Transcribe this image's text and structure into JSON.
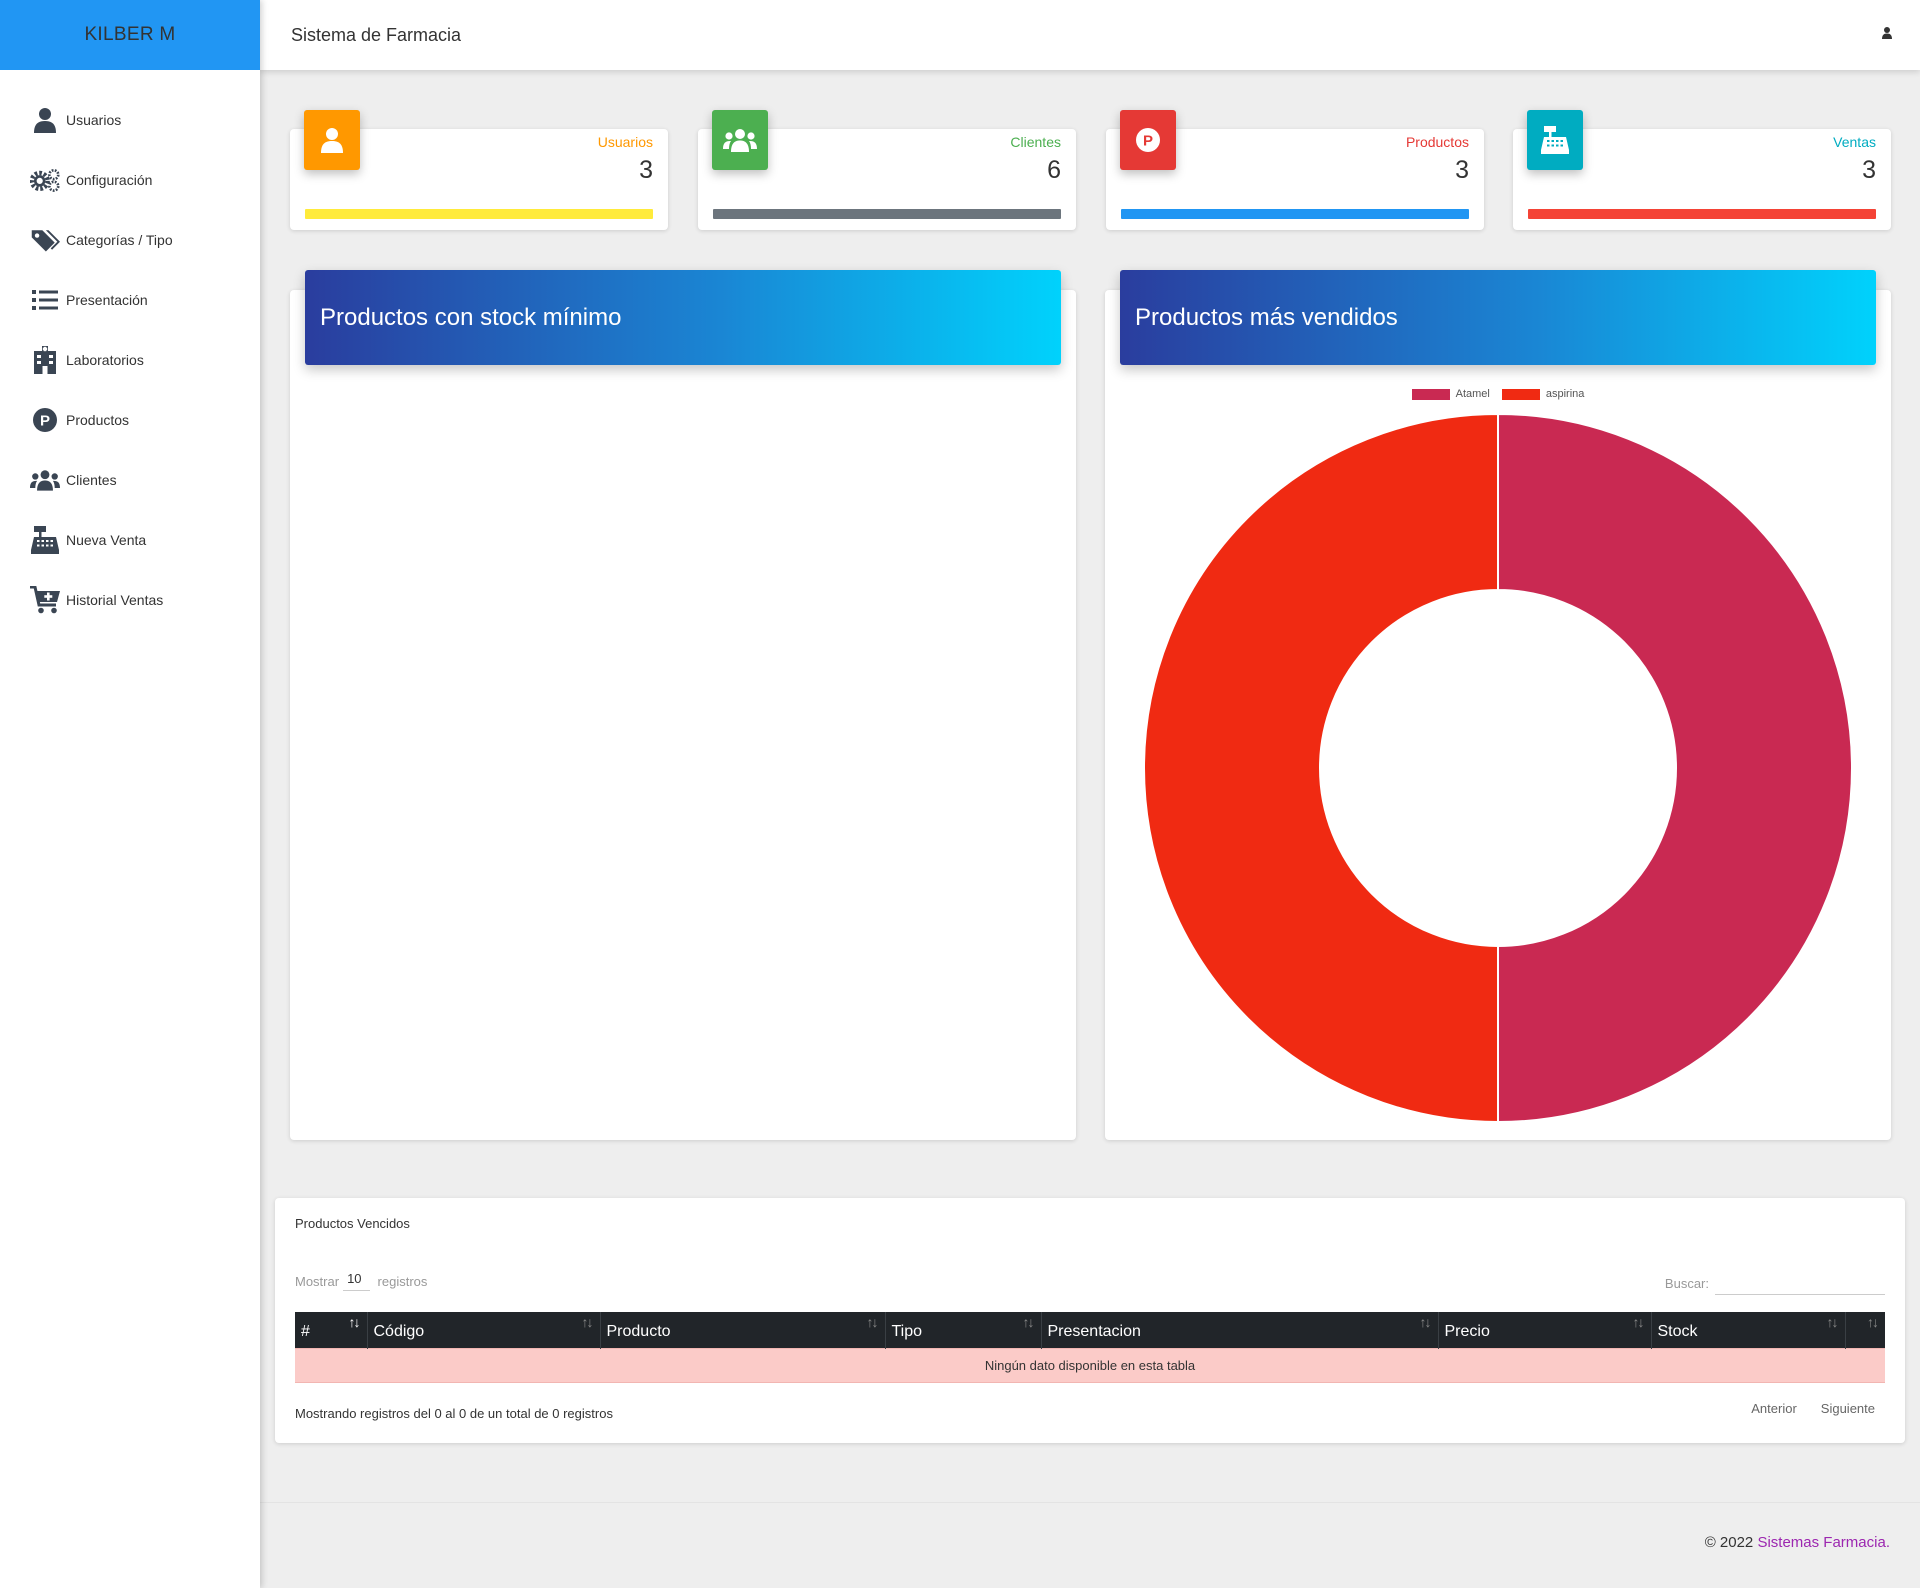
{
  "brand": "KILBER M",
  "topbar": {
    "title": "Sistema de Farmacia",
    "user_icon": "user-icon"
  },
  "sidebar": {
    "items": [
      {
        "label": "Usuarios",
        "icon": "user-icon"
      },
      {
        "label": "Configuración",
        "icon": "gears-icon"
      },
      {
        "label": "Categorías / Tipo",
        "icon": "tags-icon"
      },
      {
        "label": "Presentación",
        "icon": "list-icon"
      },
      {
        "label": "Laboratorios",
        "icon": "hospital-icon"
      },
      {
        "label": "Productos",
        "icon": "parking-p-icon"
      },
      {
        "label": "Clientes",
        "icon": "users-icon"
      },
      {
        "label": "Nueva Venta",
        "icon": "cash-register-icon"
      },
      {
        "label": "Historial Ventas",
        "icon": "cart-plus-icon"
      }
    ]
  },
  "stats": [
    {
      "label": "Usuarios",
      "value": "3",
      "accent": "#ff9800",
      "bar": "#ffeb3b",
      "icon": "user-icon"
    },
    {
      "label": "Clientes",
      "value": "6",
      "accent": "#4caf50",
      "bar": "#6c757d",
      "icon": "users-icon"
    },
    {
      "label": "Productos",
      "value": "3",
      "accent": "#e53935",
      "bar": "#2196f3",
      "icon": "parking-p-icon"
    },
    {
      "label": "Ventas",
      "value": "3",
      "accent": "#00acc1",
      "bar": "#f44336",
      "icon": "cash-register-icon"
    }
  ],
  "panels": {
    "stock_title": "Productos con stock mínimo",
    "sold_title": "Productos más vendidos"
  },
  "chart_data": {
    "type": "pie",
    "variant": "doughnut",
    "legend_position": "top",
    "categories": [
      "Atamel",
      "aspirina"
    ],
    "values": [
      1,
      1
    ],
    "colors": [
      "#c92952",
      "#f02a12"
    ]
  },
  "table": {
    "title": "Productos Vencidos",
    "show_label": "Mostrar",
    "show_value": "10",
    "records_label": "registros",
    "search_label": "Buscar:",
    "columns": [
      "#",
      "Código",
      "Producto",
      "Tipo",
      "Presentacion",
      "Precio",
      "Stock",
      ""
    ],
    "empty_text": "Ningún dato disponible en esta tabla",
    "info": "Mostrando registros del 0 al 0 de un total de 0 registros",
    "prev": "Anterior",
    "next": "Siguiente"
  },
  "footer": {
    "text": "© 2022 ",
    "link": "Sistemas Farmacia."
  }
}
